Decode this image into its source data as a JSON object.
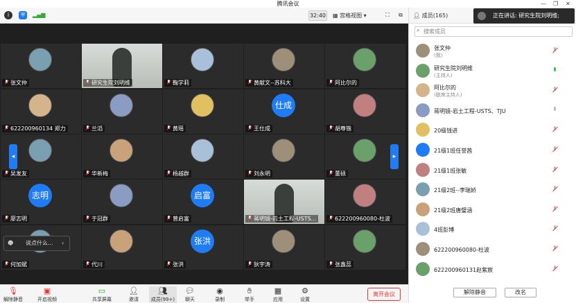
{
  "window": {
    "title": "腾讯会议"
  },
  "toolbar": {
    "timer": "32:40",
    "view_label": "宫格视图",
    "members_label": "成员(165)"
  },
  "speaking": {
    "text": "正在讲话: 研究生院刘明维;"
  },
  "tiles": [
    {
      "name": "张文仲",
      "type": "avatar"
    },
    {
      "name": "研究生院刘明维",
      "type": "video"
    },
    {
      "name": "鞠学莉",
      "type": "avatar"
    },
    {
      "name": "黄献文--苏科大",
      "type": "avatar"
    },
    {
      "name": "阿比尔的",
      "type": "avatar"
    },
    {
      "name": "622200960134 郑力",
      "type": "avatar"
    },
    {
      "name": "兰滔",
      "type": "avatar"
    },
    {
      "name": "黄瑶",
      "type": "avatar"
    },
    {
      "name": "王仕成",
      "type": "text",
      "avatar_text": "仕成"
    },
    {
      "name": "胡尊锴",
      "type": "avatar"
    },
    {
      "name": "吴发友",
      "type": "avatar"
    },
    {
      "name": "华新梅",
      "type": "avatar"
    },
    {
      "name": "杨越群",
      "type": "avatar"
    },
    {
      "name": "刘永明",
      "type": "avatar"
    },
    {
      "name": "董硕",
      "type": "avatar"
    },
    {
      "name": "廖志明",
      "type": "text",
      "avatar_text": "志明"
    },
    {
      "name": "于冠群",
      "type": "avatar"
    },
    {
      "name": "曾启富",
      "type": "text",
      "avatar_text": "启富"
    },
    {
      "name": "蒋明镜-岩土工程-USTS...",
      "type": "video"
    },
    {
      "name": "622200960080-杜波",
      "type": "avatar"
    },
    {
      "name": "何加斌",
      "type": "avatar"
    },
    {
      "name": "代川",
      "type": "avatar"
    },
    {
      "name": "张洪",
      "type": "text",
      "avatar_text": "张洪"
    },
    {
      "name": "狄宇涛",
      "type": "avatar"
    },
    {
      "name": "张鑫蕊",
      "type": "avatar"
    }
  ],
  "floatbar": {
    "text": "说点什么..."
  },
  "bottombar": {
    "items": [
      "解除静音",
      "开启视频",
      "共享屏幕",
      "邀请",
      "成员(99+)",
      "聊天",
      "录制",
      "举手",
      "应用",
      "设置"
    ],
    "leave": "离开会议"
  },
  "panel": {
    "search_placeholder": "搜索成员",
    "members": [
      {
        "name": "张文仲",
        "sub": "(我)",
        "mic": "muted"
      },
      {
        "name": "研究生院刘明维",
        "sub": "(主持人)",
        "mic": "on"
      },
      {
        "name": "阿比尔的",
        "sub": "(联席主持人)",
        "mic": "muted"
      },
      {
        "name": "蒋明镜-岩土工程-USTS、TJU",
        "sub": "",
        "mic": "off"
      },
      {
        "name": "20级钱进",
        "sub": "",
        "mic": "muted"
      },
      {
        "name": "21级1班任誉茜",
        "sub": "",
        "mic": "muted"
      },
      {
        "name": "21级1班张敏",
        "sub": "",
        "mic": "muted"
      },
      {
        "name": "21级2班--李瑞娇",
        "sub": "",
        "mic": "muted"
      },
      {
        "name": "21级2班唐璧涵",
        "sub": "",
        "mic": "muted"
      },
      {
        "name": "4班彭博",
        "sub": "",
        "mic": "muted"
      },
      {
        "name": "622200960080-杜波",
        "sub": "",
        "mic": "muted"
      },
      {
        "name": "622200960131赵紫宸",
        "sub": "",
        "mic": "muted"
      }
    ],
    "unmute_all": "解除静音",
    "rename": "改名"
  }
}
